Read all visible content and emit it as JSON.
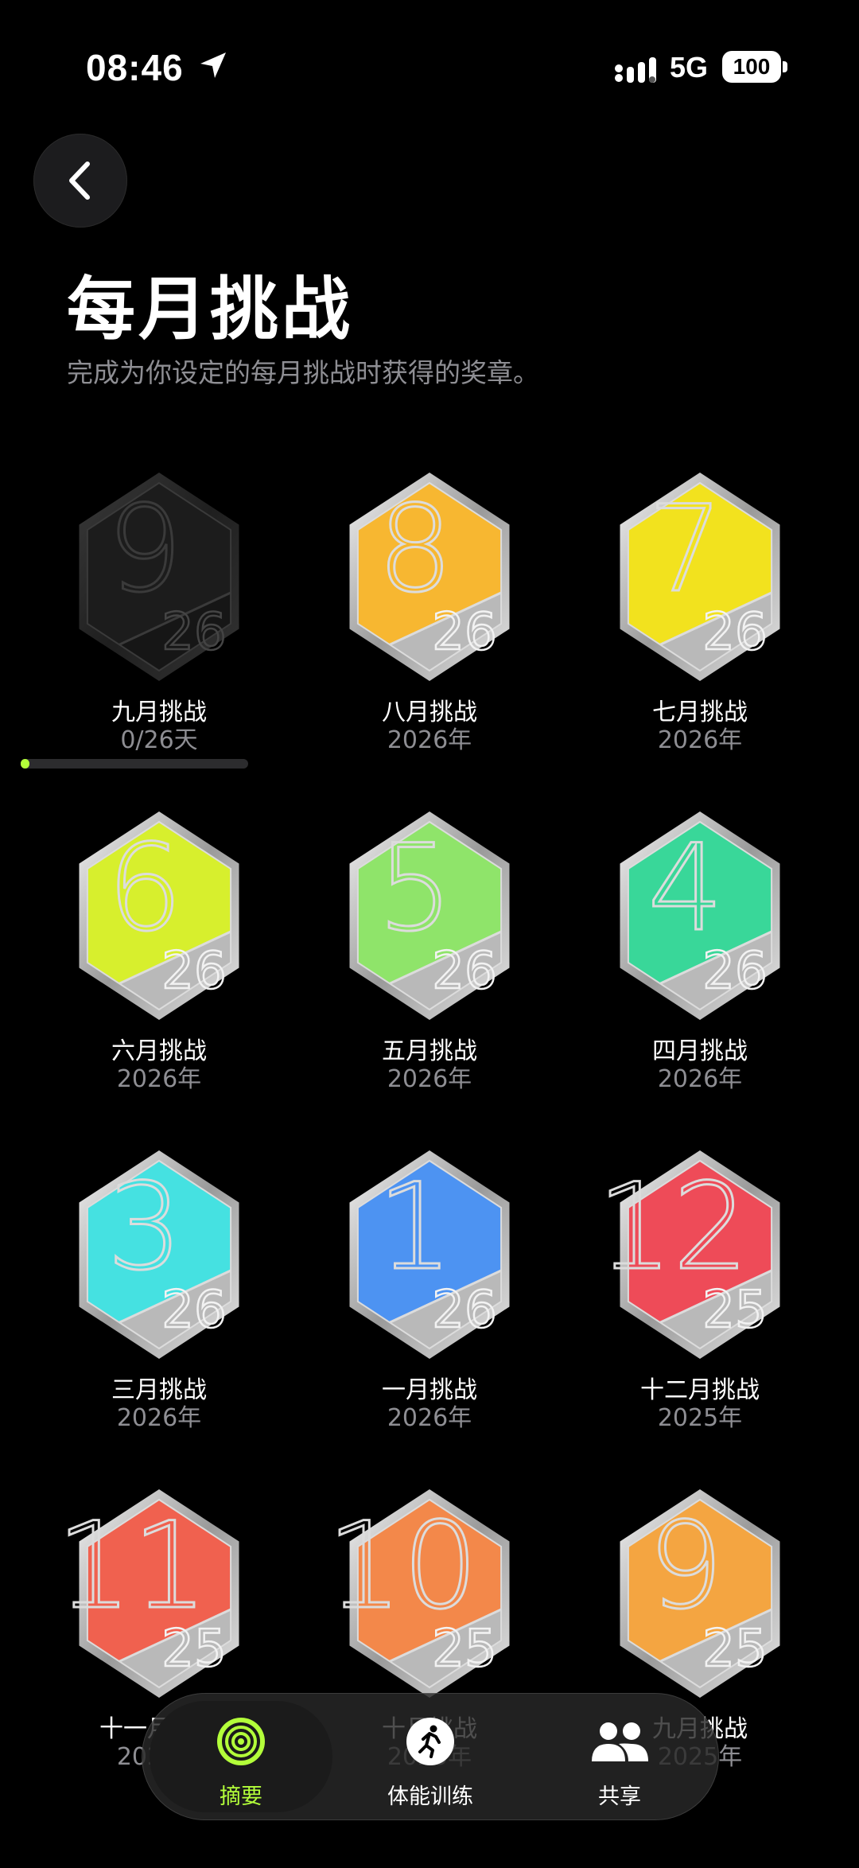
{
  "status": {
    "time": "08:46",
    "network": "5G",
    "battery": "100"
  },
  "header": {
    "title": "每月挑战",
    "subtitle": "完成为你设定的每月挑战时获得的奖章。"
  },
  "badges": [
    {
      "name": "九月挑战",
      "sub": "0/26天",
      "digit": "9",
      "year_tag": "26",
      "color": "#1c1c1c",
      "progress": 0.04
    },
    {
      "name": "八月挑战",
      "sub": "2026年",
      "digit": "8",
      "year_tag": "26",
      "color": "#f7b731"
    },
    {
      "name": "七月挑战",
      "sub": "2026年",
      "digit": "7",
      "year_tag": "26",
      "color": "#f2e21e"
    },
    {
      "name": "六月挑战",
      "sub": "2026年",
      "digit": "6",
      "year_tag": "26",
      "color": "#d7ef2d"
    },
    {
      "name": "五月挑战",
      "sub": "2026年",
      "digit": "5",
      "year_tag": "26",
      "color": "#8fe46a"
    },
    {
      "name": "四月挑战",
      "sub": "2026年",
      "digit": "4",
      "year_tag": "26",
      "color": "#39d799"
    },
    {
      "name": "三月挑战",
      "sub": "2026年",
      "digit": "3",
      "year_tag": "26",
      "color": "#45e1e1"
    },
    {
      "name": "一月挑战",
      "sub": "2026年",
      "digit": "1",
      "year_tag": "26",
      "color": "#4d93f2"
    },
    {
      "name": "十二月挑战",
      "sub": "2025年",
      "digit": "12",
      "year_tag": "25",
      "color": "#ee4b58"
    },
    {
      "name": "十一月挑战",
      "sub": "2025年",
      "digit": "11",
      "year_tag": "25",
      "color": "#f0614f"
    },
    {
      "name": "十月挑战",
      "sub": "2025年",
      "digit": "10",
      "year_tag": "25",
      "color": "#f3884a"
    },
    {
      "name": "九月挑战",
      "sub": "2025年",
      "digit": "9",
      "year_tag": "25",
      "color": "#f4a541"
    }
  ],
  "tabs": [
    {
      "label": "摘要",
      "icon": "activity-rings-icon",
      "active": true
    },
    {
      "label": "体能训练",
      "icon": "running-icon",
      "active": false
    },
    {
      "label": "共享",
      "icon": "people-icon",
      "active": false
    }
  ],
  "colors": {
    "accent": "#b3ff3a",
    "secondary_text": "#8e8e93"
  }
}
